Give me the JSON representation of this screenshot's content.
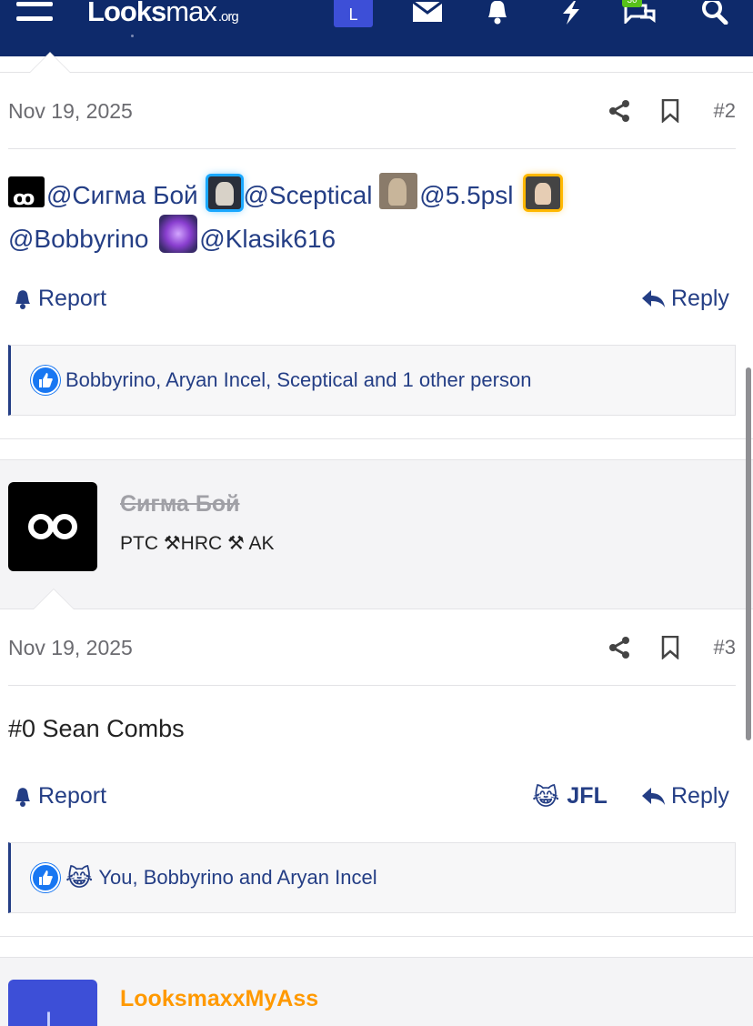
{
  "header": {
    "logo_main": "L",
    "logo_oo": "oo",
    "logo_rest": "ks",
    "logo_lite": "max",
    "logo_suffix": ".org",
    "user_avatar_letter": "L",
    "conversations_badge": "30"
  },
  "posts": [
    {
      "date": "Nov 19, 2025",
      "number": "#2",
      "mentions": {
        "m1": "@Сигма Бой",
        "m2": "@Sceptical",
        "m3": "@5.5psl",
        "m4": "@Bobbyrino",
        "m5": "@Klasik616"
      },
      "report_label": "Report",
      "reply_label": "Reply",
      "reactions_text": "Bobbyrino, Aryan Incel, Sceptical and 1 other person"
    },
    {
      "author": {
        "name": "Сигма Бой",
        "title": "PTC ⚒HRC ⚒ AK"
      },
      "date": "Nov 19, 2025",
      "number": "#3",
      "body": "#0 Sean Combs",
      "report_label": "Report",
      "jfl_label": "JFL",
      "reply_label": "Reply",
      "reactions_text": "You, Bobbyrino and Aryan Incel"
    }
  ],
  "next_author": {
    "name": "LooksmaxxMyAss",
    "avatar_letter": "L"
  },
  "icons": {
    "menu": "hamburger-icon",
    "mail": "envelope-icon",
    "alerts": "bell-icon",
    "whats_new": "bolt-icon",
    "conversations": "chat-bubbles-icon",
    "search": "search-icon",
    "share": "share-icon",
    "bookmark": "bookmark-icon",
    "report": "bell-icon",
    "reply": "reply-arrow-icon",
    "like": "thumbs-up-icon",
    "cry": "crying-laughing-emoji-icon"
  },
  "colors": {
    "nav_bg": "#0e2a6b",
    "link": "#243e85",
    "accent_avatar": "#3d4fd7",
    "username_orange": "#ff9900",
    "badge_green": "#57c21a"
  }
}
